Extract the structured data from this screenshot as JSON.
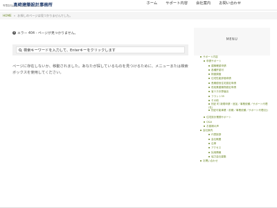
{
  "header": {
    "logo_small": "有限会社",
    "logo_main": "髙﨑建築設計事務所",
    "logo_sub": "Takasaki Architecture & Associates",
    "nav": [
      "ホーム",
      "サポート内容",
      "会社案内",
      "お問い合わせ"
    ]
  },
  "breadcrumb": {
    "home": "HOME",
    "separator": "»",
    "current": "お探しのページは見つかりませんでした。"
  },
  "main": {
    "error_icon": "info-icon",
    "error_text": "エラー 404 - ページが見つかりません。",
    "search_placeholder": "検索キーワードを入力して、Enterキーをクリックします",
    "body_text": "ページに存在しないか、移動されました。あなたが探しているものを見つけるために、メニューまたは検索ボックスを使用してください。"
  },
  "sidebar": {
    "title": "MENU",
    "items": [
      {
        "level": 0,
        "label": "サポート内容"
      },
      {
        "level": 1,
        "label": "申請サポート"
      },
      {
        "level": 2,
        "label": "建築確認申請"
      },
      {
        "level": 2,
        "label": "各種許認可"
      },
      {
        "level": 2,
        "label": "検査調査"
      },
      {
        "level": 2,
        "label": "住宅性能評価申請"
      },
      {
        "level": 2,
        "label": "長期優良住宅認定申請"
      },
      {
        "level": 2,
        "label": "低炭素建築物認定申請"
      },
      {
        "level": 2,
        "label": "省エネ計算届出"
      },
      {
        "level": 2,
        "label": "フラット35"
      },
      {
        "level": 2,
        "label": "その他"
      },
      {
        "level": 2,
        "label": "別記 町 新規申請・追加／事業依頼／サポート代理(社)"
      },
      {
        "level": 2,
        "label": "別記可能事業・前期／事業依頼／サポート代理(社)"
      },
      {
        "level": 1,
        "label": "住宅設計業務サポート"
      },
      {
        "level": 1,
        "label": "Q&A"
      },
      {
        "level": 1,
        "label": "お客様の声"
      },
      {
        "level": 0,
        "label": "会社案内"
      },
      {
        "level": 2,
        "label": "代表挨拶"
      },
      {
        "level": 2,
        "label": "会社概要"
      },
      {
        "level": 2,
        "label": "沿革"
      },
      {
        "level": 2,
        "label": "アクセス"
      },
      {
        "level": 2,
        "label": "採用情報"
      },
      {
        "level": 2,
        "label": "協力会社募集"
      },
      {
        "level": 0,
        "label": "お問い合わせ"
      }
    ]
  }
}
